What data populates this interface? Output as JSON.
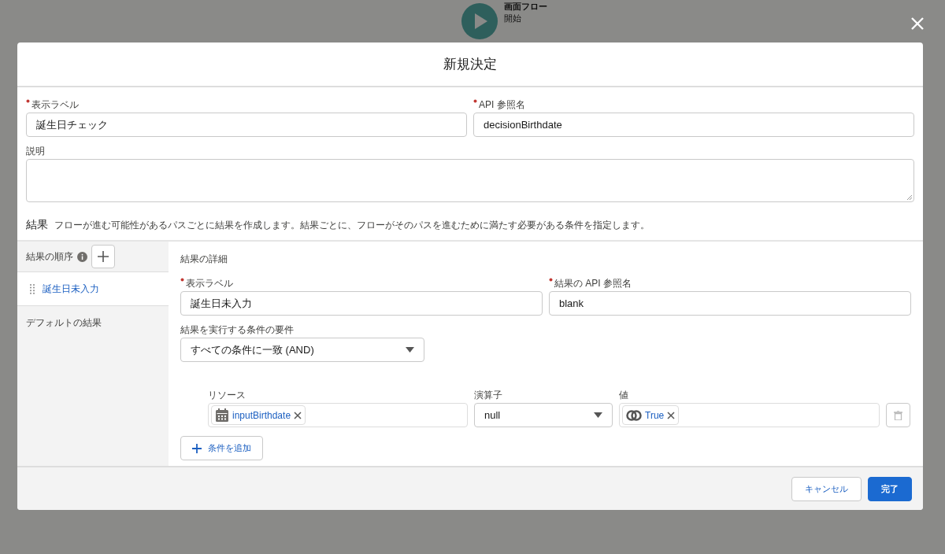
{
  "flow_node": {
    "title": "画面フロー",
    "subtitle": "開始"
  },
  "modal": {
    "title": "新規決定",
    "fields": [
      {
        "label": "表示ラベル",
        "required": true,
        "value": "誕生日チェック"
      },
      {
        "label": "API 参照名",
        "required": true,
        "value": "decisionBirthdate"
      }
    ],
    "description": {
      "label": "説明"
    },
    "outcomes_section": {
      "title": "結果",
      "help": "フローが進む可能性があるパスごとに結果を作成します。結果ごとに、フローがそのパスを進むために満たす必要がある条件を指定します。"
    },
    "sidebar": {
      "header": "結果の順序",
      "items": [
        {
          "label": "誕生日未入力",
          "selected": true,
          "draggable": true
        },
        {
          "label": "デフォルトの結果",
          "selected": false,
          "draggable": false
        }
      ]
    },
    "detail": {
      "title": "結果の詳細",
      "fields": [
        {
          "label": "表示ラベル",
          "required": true,
          "value": "誕生日未入力"
        },
        {
          "label": "結果の API 参照名",
          "required": true,
          "value": "blank"
        }
      ],
      "requirement": {
        "label": "結果を実行する条件の要件",
        "value": "すべての条件に一致 (AND)"
      },
      "condition": {
        "resource_label": "リソース",
        "resource": "inputBirthdate",
        "operator_label": "演算子",
        "operator": "null",
        "value_label": "値",
        "value": "True"
      },
      "add_condition": "条件を追加"
    },
    "buttons": [
      {
        "label": "キャンセル",
        "kind": "neutral"
      },
      {
        "label": "完了",
        "kind": "brand"
      }
    ]
  }
}
